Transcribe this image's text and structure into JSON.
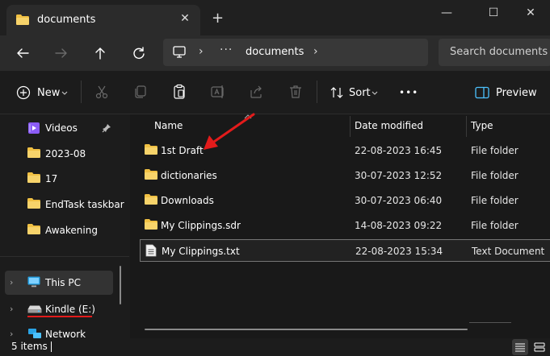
{
  "tab": {
    "title": "documents",
    "close": "✕",
    "new": "+"
  },
  "window": {
    "minimize": "—",
    "maximize": "☐",
    "close": "✕"
  },
  "address": {
    "separator": "›",
    "overflow": "···",
    "current": "documents",
    "search_placeholder": "Search documents"
  },
  "commands": {
    "new": "New",
    "sort": "Sort",
    "more": "•••",
    "preview": "Preview"
  },
  "sidebar": {
    "items": [
      {
        "label": "Videos",
        "icon": "videos-icon",
        "pinned": true
      },
      {
        "label": "2023-08",
        "icon": "folder-icon"
      },
      {
        "label": "17",
        "icon": "folder-icon"
      },
      {
        "label": "EndTask taskbar",
        "icon": "folder-icon"
      },
      {
        "label": "Awakening",
        "icon": "folder-icon"
      }
    ],
    "this_pc": "This PC",
    "kindle": "Kindle (E:)",
    "network": "Network",
    "chevron": "›"
  },
  "files": {
    "columns": [
      "Name",
      "Date modified",
      "Type"
    ],
    "rows": [
      {
        "name": "1st Draft",
        "date": "22-08-2023 16:45",
        "type": "File folder",
        "kind": "folder"
      },
      {
        "name": "dictionaries",
        "date": "30-07-2023 12:52",
        "type": "File folder",
        "kind": "folder"
      },
      {
        "name": "Downloads",
        "date": "30-07-2023 06:40",
        "type": "File folder",
        "kind": "folder"
      },
      {
        "name": "My Clippings.sdr",
        "date": "14-08-2023 09:22",
        "type": "File folder",
        "kind": "folder"
      },
      {
        "name": "My Clippings.txt",
        "date": "22-08-2023 15:34",
        "type": "Text Document",
        "kind": "text"
      }
    ]
  },
  "status": {
    "items": "5 items"
  },
  "colors": {
    "folder": "#f0c043",
    "accent": "#4cc2ff",
    "annotation": "#e31b1b"
  }
}
